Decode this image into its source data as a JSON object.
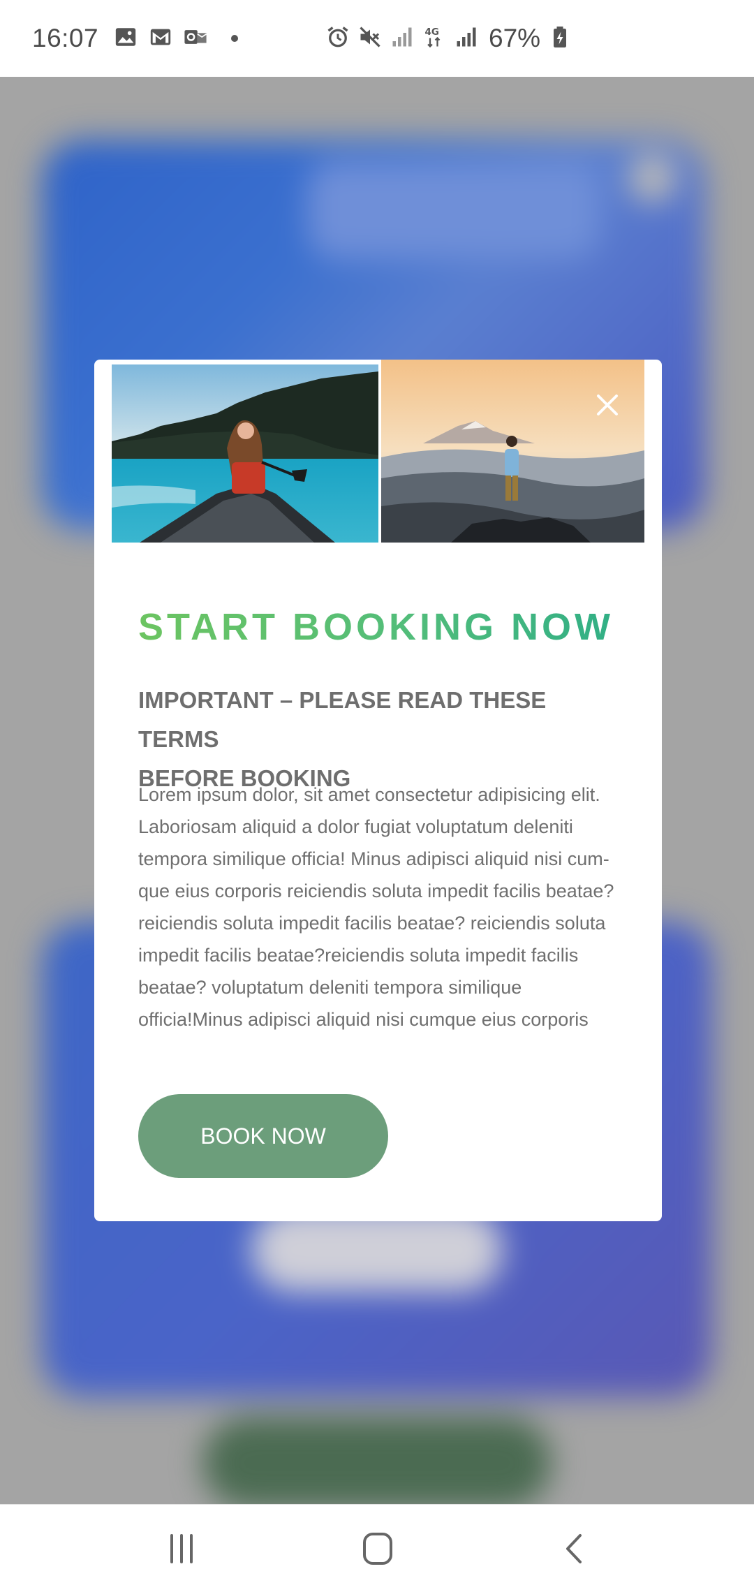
{
  "status_bar": {
    "time": "16:07",
    "battery": "67%",
    "left_icons": [
      "image-icon",
      "gmail-icon",
      "outlook-icon",
      "notification-dot"
    ],
    "right_icons": [
      "alarm-icon",
      "mute-icon",
      "signal-icon",
      "4g-icon",
      "signal-icon",
      "battery-charging-icon"
    ]
  },
  "modal": {
    "images": [
      {
        "name": "lake-canoe-photo"
      },
      {
        "name": "mountain-hiker-photo"
      }
    ],
    "close_icon": "close-icon",
    "title": "START BOOKING NOW",
    "subtitle_line1": "IMPORTANT – PLEASE READ THESE TERMS",
    "subtitle_line2": "BEFORE BOOKING",
    "body_lines": [
      "Lorem ipsum dolor, sit amet consectetur adipisicing elit.",
      "Laboriosam aliquid a dolor fugiat voluptatum deleniti",
      "tempora similique officia! Minus adipisci aliquid nisi cum-",
      "que eius corporis reiciendis soluta impedit facilis beatae?",
      "reiciendis soluta impedit facilis beatae? reiciendis soluta",
      "impedit facilis beatae?reiciendis soluta impedit facilis",
      "beatae? voluptatum deleniti tempora similique",
      "officia!Minus adipisci aliquid nisi cumque eius corporis"
    ],
    "button_label": "BOOK NOW",
    "colors": {
      "title_gradient_start": "#6cc461",
      "title_gradient_end": "#2fae86",
      "button": "#6c9e7b",
      "overlay": "#a4a4a4"
    }
  },
  "nav_bar": {
    "buttons": [
      "recents-icon",
      "home-icon",
      "back-icon"
    ]
  }
}
